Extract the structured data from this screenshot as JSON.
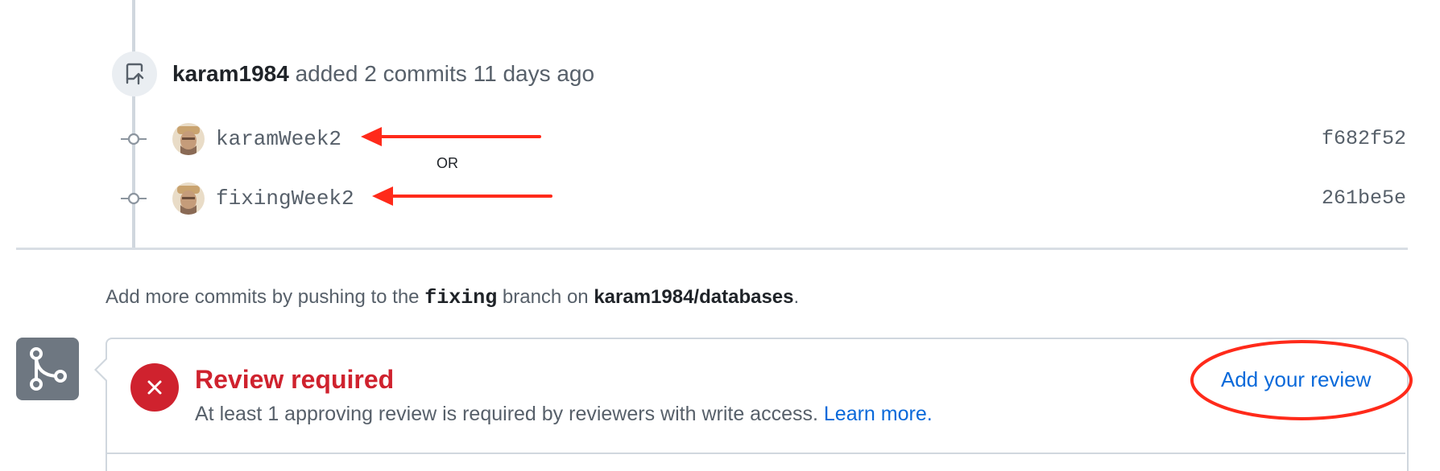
{
  "push_event": {
    "author": "karam1984",
    "action": "added 2 commits",
    "time": "11 days ago"
  },
  "commits": [
    {
      "message": "karamWeek2",
      "sha": "f682f52"
    },
    {
      "message": "fixingWeek2",
      "sha": "261be5e"
    }
  ],
  "annotation": {
    "or_label": "OR",
    "arrow_color": "#ff2a1a"
  },
  "hint": {
    "prefix": "Add more commits by pushing to the",
    "branch": "fixing",
    "middle": "branch on",
    "repo": "karam1984/databases",
    "suffix": "."
  },
  "merge_box": {
    "title": "Review required",
    "description": "At least 1 approving review is required by reviewers with write access.",
    "learn_more": "Learn more.",
    "action_label": "Add your review",
    "status_color": "#cf222e",
    "link_color": "#0969da"
  },
  "icons": {
    "push": "repo-push-icon",
    "commit": "git-commit-icon",
    "merge": "git-merge-icon",
    "status": "x-circle-icon"
  }
}
